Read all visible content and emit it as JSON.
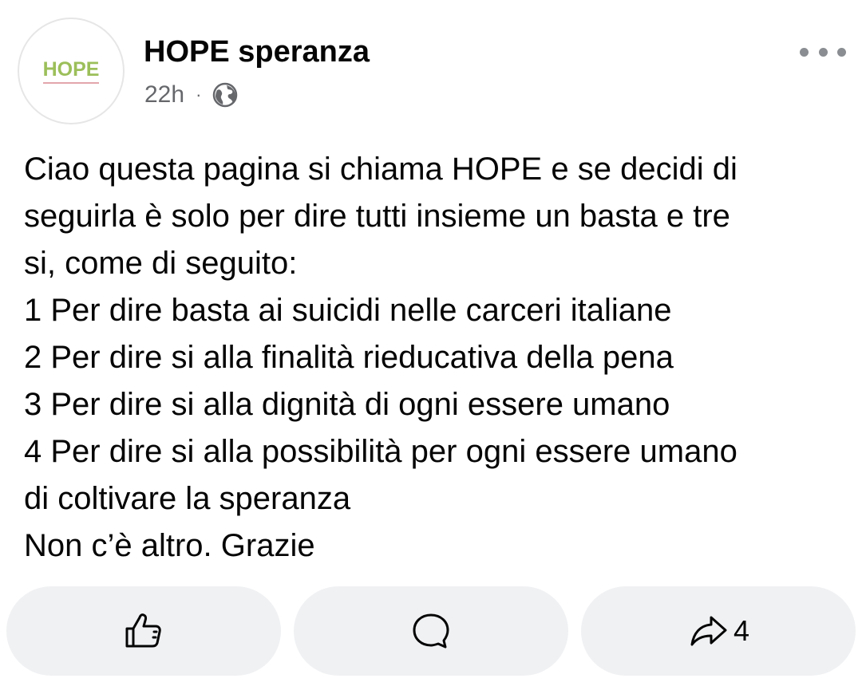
{
  "post": {
    "author": {
      "name": "HOPE speranza",
      "avatar_logo_text": "HOPE"
    },
    "meta": {
      "time": "22h",
      "separator": "·",
      "audience_icon": "globe-icon"
    },
    "more_icon": "more-dots-icon",
    "text_lines": [
      "Ciao questa pagina si chiama HOPE e se decidi di",
      "seguirla è solo per dire tutti insieme un basta e tre",
      "si, come di seguito:",
      "1 Per dire basta ai suicidi nelle carceri italiane",
      "2 Per dire si alla finalità rieducativa della pena",
      "3 Per dire si alla dignità di ogni essere umano",
      "4 Per dire si alla possibilità per ogni essere umano",
      "di coltivare la speranza",
      "Non c’è altro. Grazie"
    ]
  },
  "actions": {
    "like": {
      "icon": "thumbs-up-icon"
    },
    "comment": {
      "icon": "comment-bubble-icon"
    },
    "share": {
      "icon": "share-arrow-icon",
      "count": "4"
    }
  },
  "colors": {
    "text_primary": "#050505",
    "text_secondary": "#65676b",
    "button_background": "#f0f1f3",
    "logo_green": "#9cbf5a",
    "logo_underline_pink": "#e2a6ad"
  }
}
